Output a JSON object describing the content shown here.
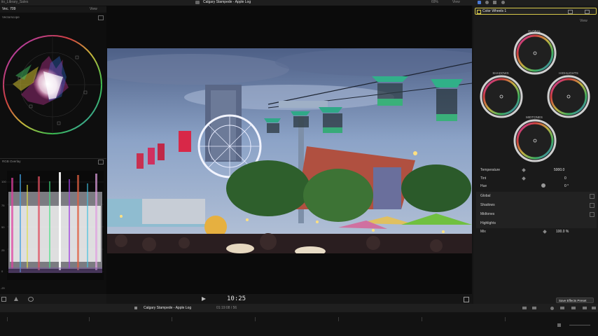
{
  "app": {
    "window_title": "Calgary Stampede - Apple Log",
    "library_label": "iio_Library_Sales",
    "zoom": "69%",
    "view_label": "View"
  },
  "left_panel": {
    "scope_title": "Vec. 709",
    "view_label": "View",
    "vectorscope_label": "Vectorscope",
    "waveform_label": "RGB Overlay",
    "waveform_scale": [
      "100",
      "75",
      "50",
      "25",
      "0"
    ],
    "waveform_bottom": "-20"
  },
  "viewer": {
    "timecode": "10:25"
  },
  "inspector": {
    "effect_name": "Color Wheels 1",
    "view_label": "View",
    "wheels": {
      "global": "GLOBAL",
      "shadows": "SHADOWS",
      "highlights": "HIGHLIGHTS",
      "midtones": "MIDTONES"
    },
    "params": [
      {
        "label": "Temperature",
        "value": "5000.0"
      },
      {
        "label": "Tint",
        "value": "0"
      },
      {
        "label": "Hue",
        "value": "0 °"
      }
    ],
    "sections": [
      "Global",
      "Shadows",
      "Midtones",
      "Highlights"
    ],
    "mix_label": "Mix",
    "mix_value": "100.0 %",
    "save_button": "Save Effects Preset"
  },
  "timeline": {
    "project_name": "Calgary Stampede - Apple Log",
    "duration": "01:19:08 / 56"
  },
  "colors": {
    "accent_yellow": "#d7c84a",
    "panel_bg": "#1c1c1c",
    "background": "#141414"
  }
}
